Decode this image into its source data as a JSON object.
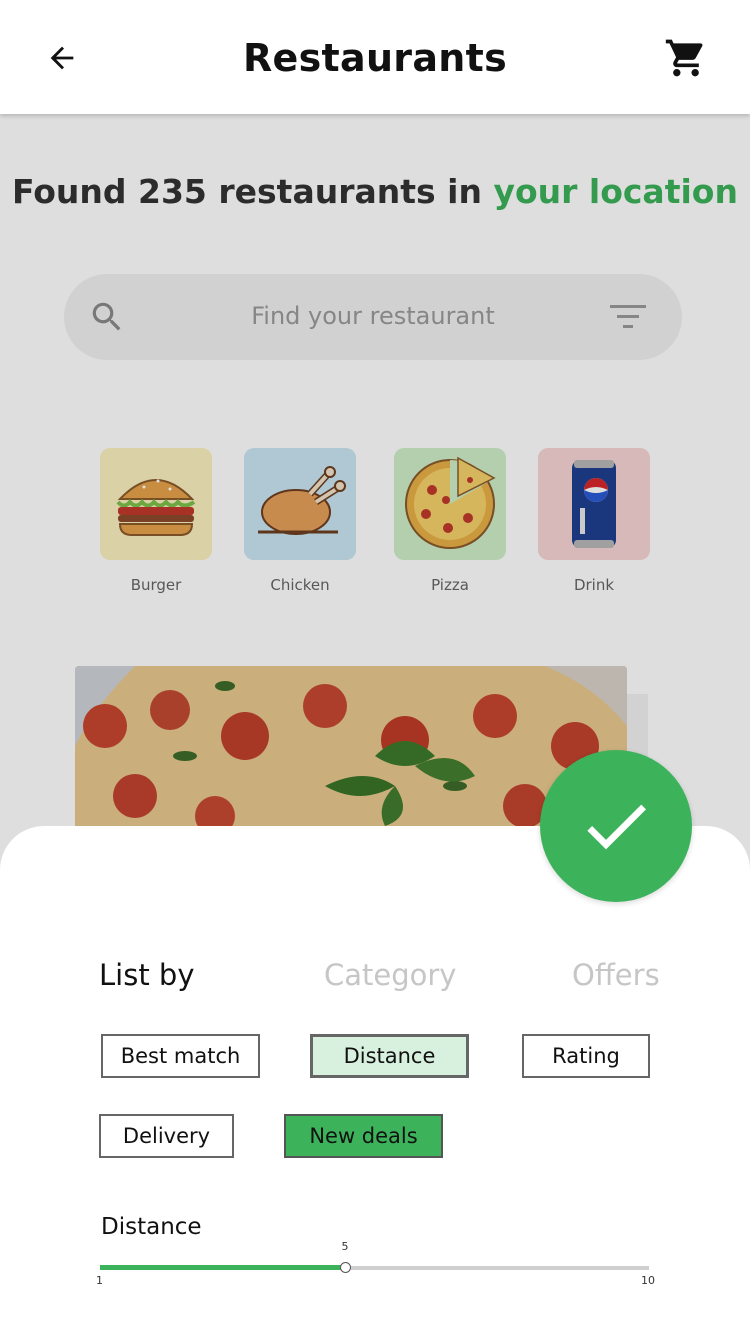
{
  "appbar": {
    "title": "Restaurants",
    "back_icon": "arrow-left-icon",
    "cart_icon": "shopping-cart-icon"
  },
  "main": {
    "headline_prefix": "Found 235 restaurants in ",
    "headline_accent": "your location",
    "search_placeholder": "Find your restaurant",
    "categories": [
      {
        "label": "Burger",
        "icon": "burger-icon",
        "color": "#fbf0c0"
      },
      {
        "label": "Chicken",
        "icon": "chicken-icon",
        "color": "#c9e6f4"
      },
      {
        "label": "Pizza",
        "icon": "pizza-icon",
        "color": "#cfeec7"
      },
      {
        "label": "Drink",
        "icon": "soda-can-icon",
        "color": "#f8d5d5"
      }
    ]
  },
  "sheet": {
    "tabs": [
      "List by",
      "Category",
      "Offers"
    ],
    "chips": [
      "Best match",
      "Distance",
      "Rating",
      "Delivery",
      "New deals"
    ],
    "distance_label": "Distance",
    "slider": {
      "min": 1,
      "max": 10,
      "value": 5,
      "min_label": "1",
      "max_label": "10",
      "value_label": "5"
    }
  },
  "colors": {
    "accent": "#3cb35a",
    "selected_chip": "#d8f1df"
  }
}
